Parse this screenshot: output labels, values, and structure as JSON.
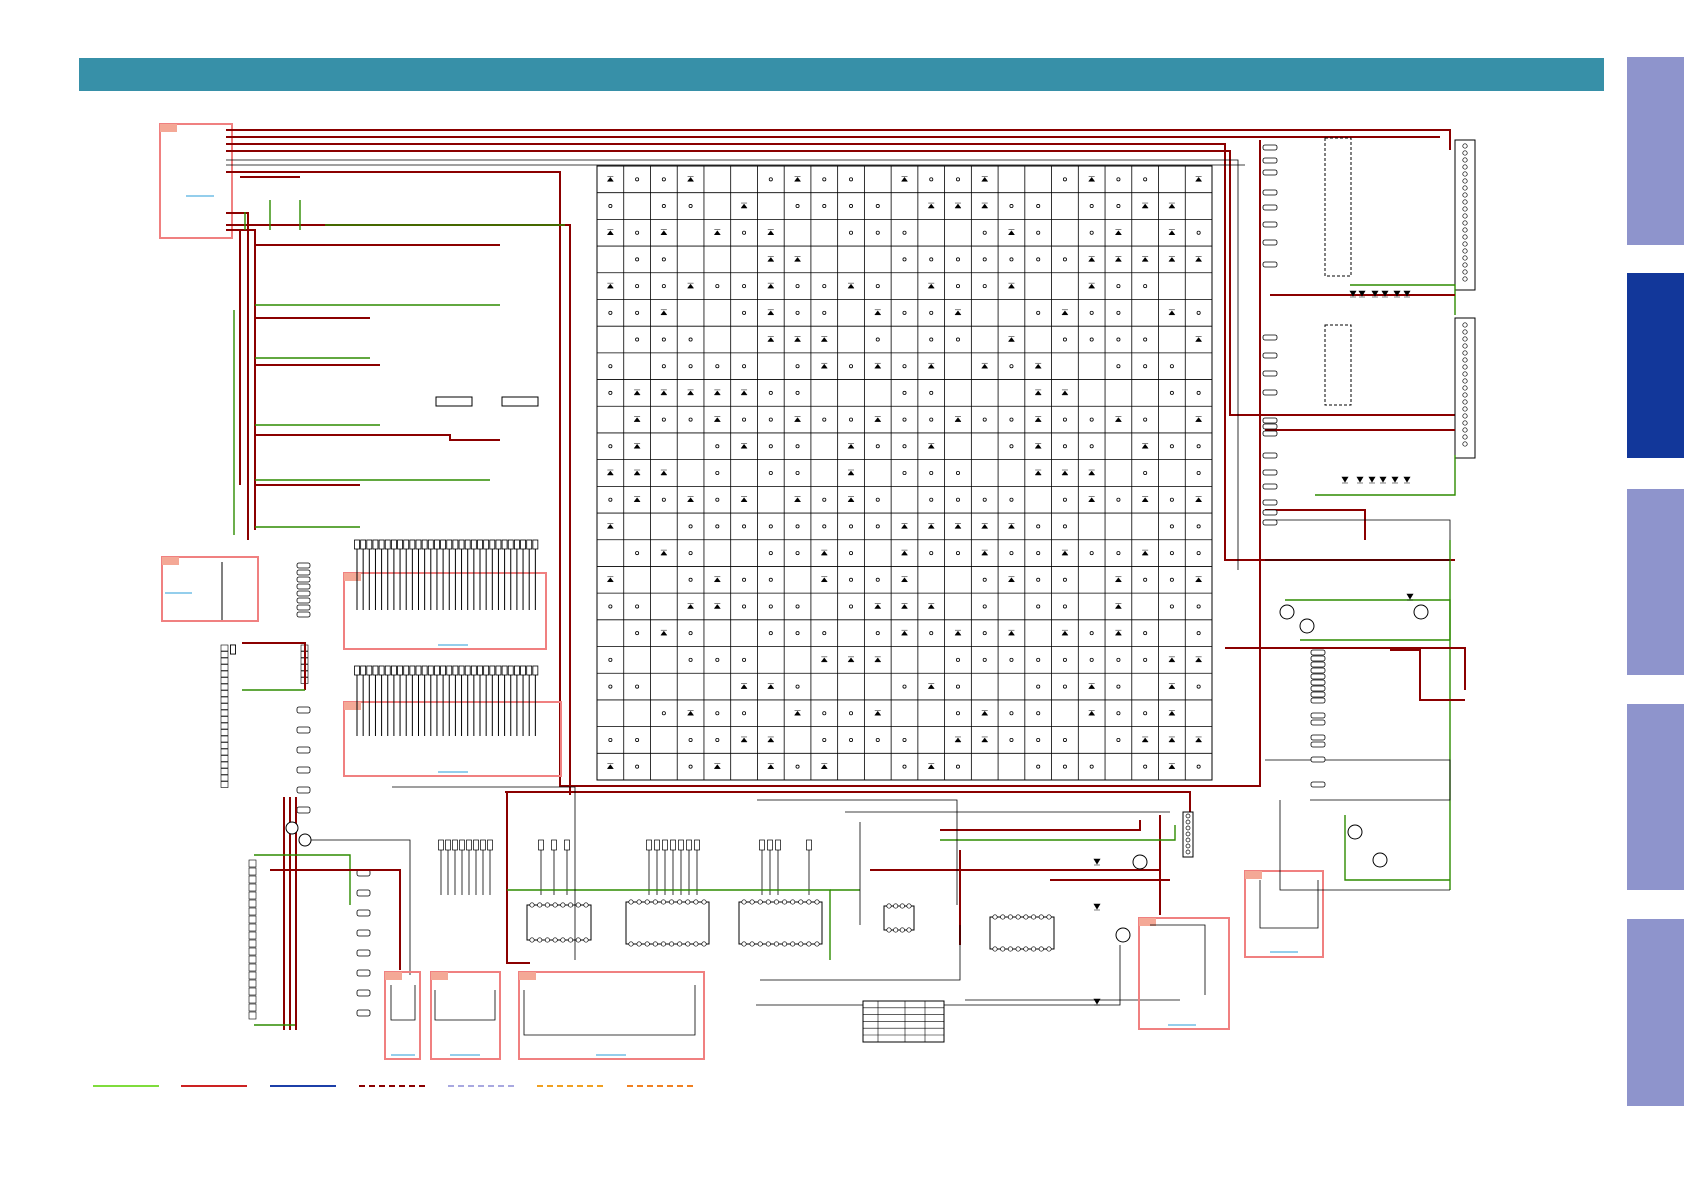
{
  "colors": {
    "header": "#3790a8",
    "tab_inactive": "#8e94cc",
    "tab_active": "#12379a",
    "wire_main": "#8b0000",
    "wire_ground": "#2e8b00",
    "grid": "#000000"
  },
  "side_tabs": [
    {
      "state": "inactive"
    },
    {
      "state": "active"
    },
    {
      "state": "inactive"
    },
    {
      "state": "inactive"
    },
    {
      "state": "inactive"
    }
  ],
  "legend": [
    {
      "color": "#7fdc3c",
      "style": "solid"
    },
    {
      "color": "#cc2222",
      "style": "solid"
    },
    {
      "color": "#1c3fa8",
      "style": "solid"
    },
    {
      "color": "#8b0000",
      "style": "dashed"
    },
    {
      "color": "#a8a8e0",
      "style": "dashed"
    },
    {
      "color": "#f0a020",
      "style": "dashed"
    },
    {
      "color": "#f08020",
      "style": "dashed"
    }
  ],
  "matrix": {
    "rows": 23,
    "cols": 23
  }
}
